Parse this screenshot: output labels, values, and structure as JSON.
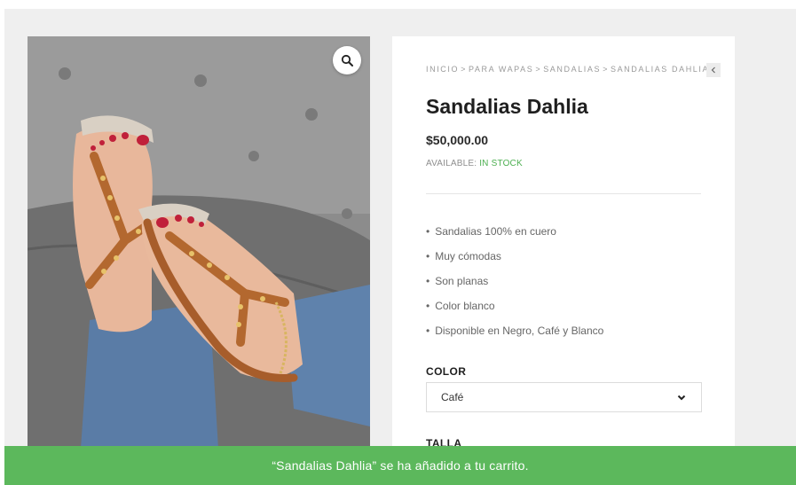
{
  "breadcrumb": {
    "items": [
      "INICIO",
      "PARA WAPAS",
      "SANDALIAS",
      "SANDALIAS DAHLIA"
    ],
    "separator": ">"
  },
  "product": {
    "title": "Sandalias Dahlia",
    "price": "$50,000.00",
    "availability_label": "AVAILABLE:",
    "availability_value": "IN STOCK",
    "features": [
      "Sandalias 100% en cuero",
      "Muy cómodas",
      "Son planas",
      "Color blanco",
      "Disponible en Negro, Café y Blanco"
    ]
  },
  "options": {
    "color_label": "COLOR",
    "color_selected": "Café",
    "size_label": "TALLA"
  },
  "notice": {
    "message": "“Sandalias Dahlia” se ha añadido a tu carrito."
  },
  "icons": {
    "zoom": "magnifier-icon",
    "previous": "chevron-left-icon",
    "dropdown": "chevron-down-icon"
  },
  "colors": {
    "accent_green": "#5cb85c",
    "stock_green": "#4caf50",
    "background": "#efefef"
  }
}
